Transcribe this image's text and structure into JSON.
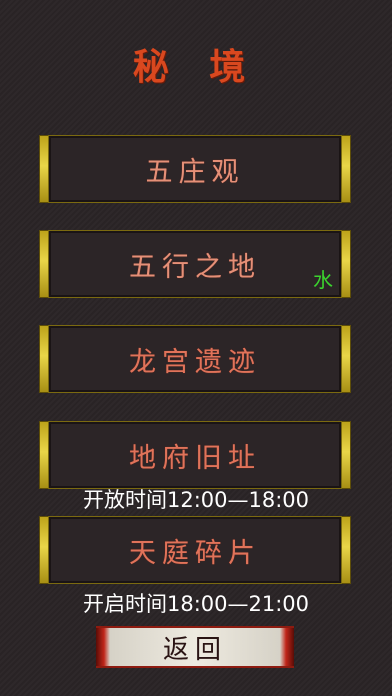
{
  "title": "秘 境",
  "buttons": [
    {
      "label": "五庄观"
    },
    {
      "label": "五行之地",
      "badge": "水"
    },
    {
      "label": "龙宫遗迹"
    },
    {
      "label": "地府旧址",
      "note": "开放时间12:00—18:00"
    },
    {
      "label": "天庭碎片",
      "note": "开启时间18:00—21:00"
    }
  ],
  "back_label": "返回",
  "colors": {
    "title": "#d9481f",
    "gold_frame": "#e9d548",
    "button_text": "#e59078",
    "badge_green": "#3bd42e",
    "back_red": "#c1261a"
  }
}
